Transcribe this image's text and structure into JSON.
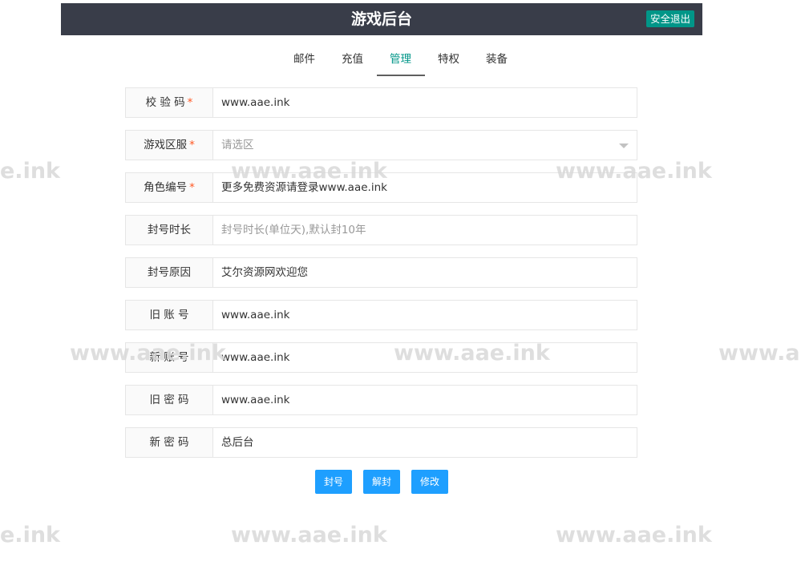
{
  "header": {
    "title": "游戏后台",
    "logout_label": "安全退出"
  },
  "tabs": [
    {
      "label": "邮件",
      "active": false
    },
    {
      "label": "充值",
      "active": false
    },
    {
      "label": "管理",
      "active": true
    },
    {
      "label": "特权",
      "active": false
    },
    {
      "label": "装备",
      "active": false
    }
  ],
  "form": {
    "fields": [
      {
        "label": "校 验 码",
        "required": true,
        "value": "www.aae.ink",
        "placeholder": ""
      },
      {
        "label": "游戏区服",
        "required": true,
        "value": "",
        "placeholder": "请选区",
        "type": "select"
      },
      {
        "label": "角色编号",
        "required": true,
        "value": "更多免费资源请登录www.aae.ink",
        "placeholder": ""
      },
      {
        "label": "封号时长",
        "required": false,
        "value": "",
        "placeholder": "封号时长(单位天),默认封10年"
      },
      {
        "label": "封号原因",
        "required": false,
        "value": "艾尔资源网欢迎您",
        "placeholder": ""
      },
      {
        "label": "旧 账 号",
        "required": false,
        "value": "www.aae.ink",
        "placeholder": ""
      },
      {
        "label": "新 账 号",
        "required": false,
        "value": "www.aae.ink",
        "placeholder": ""
      },
      {
        "label": "旧 密 码",
        "required": false,
        "value": "www.aae.ink",
        "placeholder": ""
      },
      {
        "label": "新 密 码",
        "required": false,
        "value": "总后台",
        "placeholder": ""
      }
    ],
    "required_mark": "*"
  },
  "buttons": {
    "ban_label": "封号",
    "unban_label": "解封",
    "modify_label": "修改"
  },
  "watermark": {
    "text": "www.aae.ink",
    "text_left_cut": "e.ink",
    "text_right_cut": "www.a"
  },
  "colors": {
    "header_bg": "#393d49",
    "accent": "#009688",
    "button": "#1e9fff",
    "required": "#ff5722"
  }
}
